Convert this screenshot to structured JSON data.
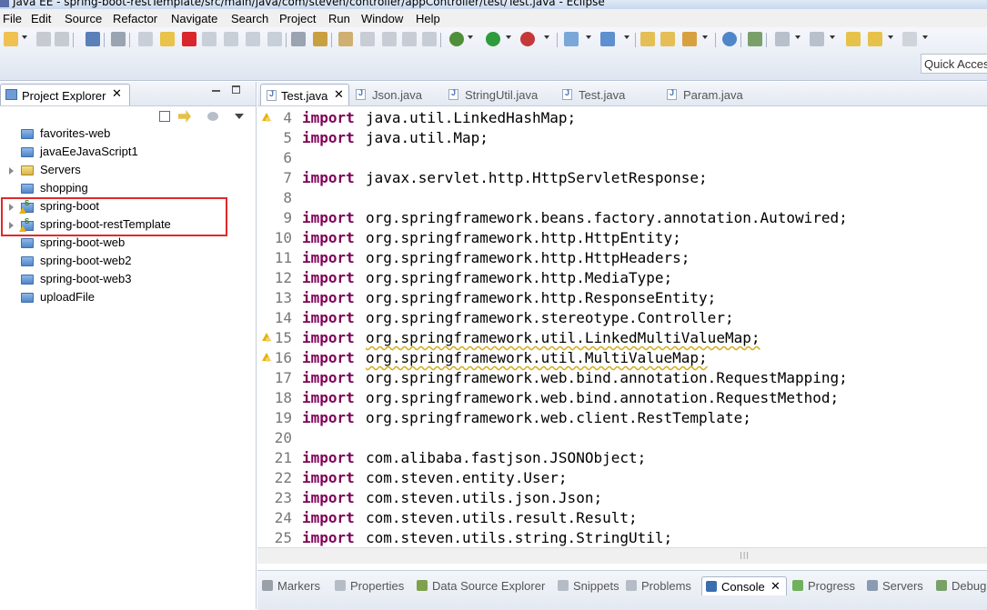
{
  "window": {
    "title": "Java EE - spring-boot-restTemplate/src/main/java/com/steven/controller/appController/test/Test.java - Eclipse"
  },
  "menu": [
    "File",
    "Edit",
    "Source",
    "Refactor",
    "Navigate",
    "Search",
    "Project",
    "Run",
    "Window",
    "Help"
  ],
  "toolbar": {
    "quick_access_placeholder": "Quick Access"
  },
  "project_explorer": {
    "tab_label": "Project Explorer",
    "close_glyph": "✕",
    "items": [
      {
        "label": "favorites-web",
        "icon": "project-folder-icon",
        "expandable": false
      },
      {
        "label": "javaEeJavaScript1",
        "icon": "project-folder-icon",
        "expandable": false
      },
      {
        "label": "Servers",
        "icon": "open-folder-icon",
        "expandable": true
      },
      {
        "label": "shopping",
        "icon": "project-folder-icon",
        "expandable": false
      },
      {
        "label": "spring-boot",
        "icon": "spring-project-warning-icon",
        "expandable": true
      },
      {
        "label": "spring-boot-restTemplate",
        "icon": "spring-project-warning-icon",
        "expandable": true
      },
      {
        "label": "spring-boot-web",
        "icon": "project-folder-icon",
        "expandable": false
      },
      {
        "label": "spring-boot-web2",
        "icon": "project-folder-icon",
        "expandable": false
      },
      {
        "label": "spring-boot-web3",
        "icon": "project-folder-icon",
        "expandable": false
      },
      {
        "label": "uploadFile",
        "icon": "project-folder-icon",
        "expandable": false
      }
    ]
  },
  "editor": {
    "tabs": [
      {
        "label": "Test.java",
        "active": true
      },
      {
        "label": "Json.java",
        "active": false
      },
      {
        "label": "StringUtil.java",
        "active": false
      },
      {
        "label": "Test.java",
        "active": false
      },
      {
        "label": "Param.java",
        "active": false
      }
    ],
    "lines": [
      {
        "n": "4",
        "kw": "import",
        "text": "java.util.LinkedHashMap;",
        "warn": true,
        "squiggle": false
      },
      {
        "n": "5",
        "kw": "import",
        "text": "java.util.Map;",
        "warn": false,
        "squiggle": false
      },
      {
        "n": "6",
        "kw": "",
        "text": "",
        "warn": false,
        "squiggle": false
      },
      {
        "n": "7",
        "kw": "import",
        "text": "javax.servlet.http.HttpServletResponse;",
        "warn": false,
        "squiggle": false
      },
      {
        "n": "8",
        "kw": "",
        "text": "",
        "warn": false,
        "squiggle": false
      },
      {
        "n": "9",
        "kw": "import",
        "text": "org.springframework.beans.factory.annotation.Autowired;",
        "warn": false,
        "squiggle": false
      },
      {
        "n": "10",
        "kw": "import",
        "text": "org.springframework.http.HttpEntity;",
        "warn": false,
        "squiggle": false
      },
      {
        "n": "11",
        "kw": "import",
        "text": "org.springframework.http.HttpHeaders;",
        "warn": false,
        "squiggle": false
      },
      {
        "n": "12",
        "kw": "import",
        "text": "org.springframework.http.MediaType;",
        "warn": false,
        "squiggle": false
      },
      {
        "n": "13",
        "kw": "import",
        "text": "org.springframework.http.ResponseEntity;",
        "warn": false,
        "squiggle": false
      },
      {
        "n": "14",
        "kw": "import",
        "text": "org.springframework.stereotype.Controller;",
        "warn": false,
        "squiggle": false
      },
      {
        "n": "15",
        "kw": "import",
        "text": "org.springframework.util.LinkedMultiValueMap;",
        "warn": true,
        "squiggle": true
      },
      {
        "n": "16",
        "kw": "import",
        "text": "org.springframework.util.MultiValueMap;",
        "warn": true,
        "squiggle": true
      },
      {
        "n": "17",
        "kw": "import",
        "text": "org.springframework.web.bind.annotation.RequestMapping;",
        "warn": false,
        "squiggle": false
      },
      {
        "n": "18",
        "kw": "import",
        "text": "org.springframework.web.bind.annotation.RequestMethod;",
        "warn": false,
        "squiggle": false
      },
      {
        "n": "19",
        "kw": "import",
        "text": "org.springframework.web.client.RestTemplate;",
        "warn": false,
        "squiggle": false
      },
      {
        "n": "20",
        "kw": "",
        "text": "",
        "warn": false,
        "squiggle": false
      },
      {
        "n": "21",
        "kw": "import",
        "text": "com.alibaba.fastjson.JSONObject;",
        "warn": false,
        "squiggle": false
      },
      {
        "n": "22",
        "kw": "import",
        "text": "com.steven.entity.User;",
        "warn": false,
        "squiggle": false
      },
      {
        "n": "23",
        "kw": "import",
        "text": "com.steven.utils.json.Json;",
        "warn": false,
        "squiggle": false
      },
      {
        "n": "24",
        "kw": "import",
        "text": "com.steven.utils.result.Result;",
        "warn": false,
        "squiggle": false
      },
      {
        "n": "25",
        "kw": "import",
        "text": "com.steven.utils.string.StringUtil;",
        "warn": false,
        "squiggle": false
      }
    ]
  },
  "bottom_panel": {
    "tabs": [
      {
        "label": "Markers",
        "icon": "markers-icon",
        "color": "#9aa0a8",
        "active": false
      },
      {
        "label": "Properties",
        "icon": "properties-icon",
        "color": "#b5bcc6",
        "active": false
      },
      {
        "label": "Data Source Explorer",
        "icon": "data-source-icon",
        "color": "#7ea14c",
        "active": false
      },
      {
        "label": "Snippets",
        "icon": "snippets-icon",
        "color": "#b5bcc6",
        "active": false
      },
      {
        "label": "Problems",
        "icon": "problems-icon",
        "color": "#b5bcc6",
        "active": false
      },
      {
        "label": "Console",
        "icon": "console-icon",
        "color": "#3c6db0",
        "active": true
      },
      {
        "label": "Progress",
        "icon": "progress-icon",
        "color": "#6fb05a",
        "active": false
      },
      {
        "label": "Servers",
        "icon": "servers-icon",
        "color": "#8a9ab0",
        "active": false
      },
      {
        "label": "Debug",
        "icon": "debug-icon",
        "color": "#7aa06a",
        "active": false
      }
    ]
  },
  "colors": {
    "keyword": "#7f0055",
    "highlight_box": "#e0292b",
    "warning": "#e7b20d"
  }
}
